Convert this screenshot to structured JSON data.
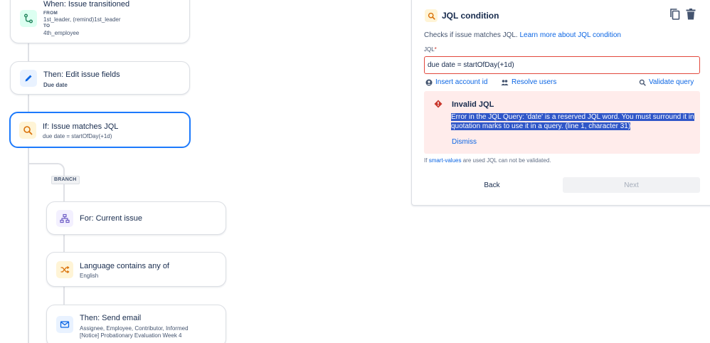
{
  "flow": {
    "trigger": {
      "title": "When: Issue transitioned",
      "from_label": "FROM",
      "from_value": "1st_leader, (remind)1st_leader",
      "to_label": "TO",
      "to_value": "4th_employee"
    },
    "edit": {
      "title": "Then: Edit issue fields",
      "subtitle": "Due date"
    },
    "condition": {
      "title": "If: Issue matches JQL",
      "subtitle": "due date = startOfDay(+1d)"
    },
    "branch_tag": "BRANCH",
    "for_current": {
      "title": "For: Current issue"
    },
    "language": {
      "title": "Language contains any of",
      "subtitle": "English"
    },
    "send_email": {
      "title": "Then: Send email",
      "line1": "Assignee, Employee, Contributor, Informed",
      "line2": "[Notice] Probationary Evaluation Week 4"
    }
  },
  "panel": {
    "title": "JQL condition",
    "description": "Checks if issue matches JQL.",
    "learn_more": "Learn more about JQL condition",
    "jql_label": "JQL",
    "required_mark": "*",
    "jql_value": "due date = startOfDay(+1d)",
    "insert_account_id": "Insert account id",
    "resolve_users": "Resolve users",
    "validate_query": "Validate query",
    "error": {
      "title": "Invalid JQL",
      "message": "Error in the JQL Query: 'date' is a reserved JQL word. You must surround it in quotation marks to use it in a query. (line 1, character 31)",
      "dismiss": "Dismiss"
    },
    "note_prefix": "If",
    "note_link": "smart-values",
    "note_suffix": "are used JQL can not be validated.",
    "back": "Back",
    "next": "Next"
  },
  "colors": {
    "accent": "#1d7afc",
    "error": "#c9372c",
    "link": "#0c66e4",
    "selection": "#2f56c8"
  }
}
